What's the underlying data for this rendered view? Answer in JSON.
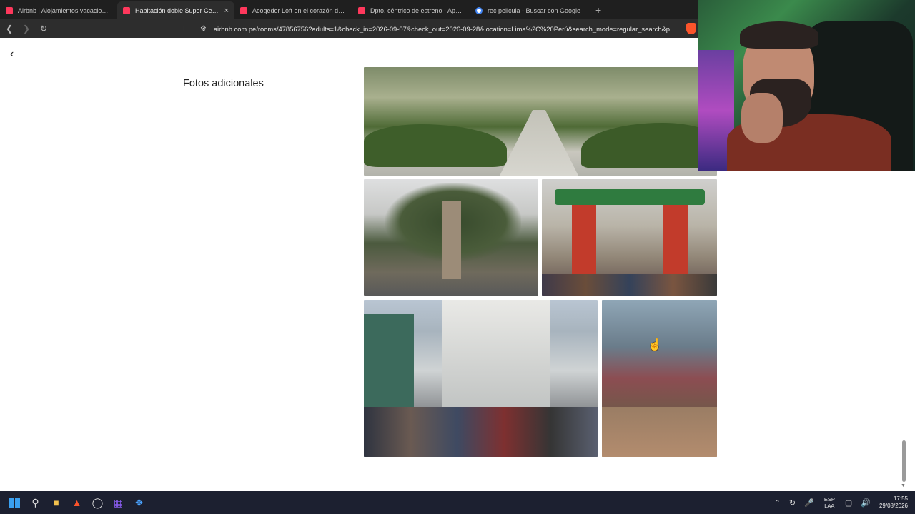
{
  "browser": {
    "tabs": [
      {
        "title": "Airbnb | Alojamientos vacacionales y",
        "favicon_color": "#ff385c",
        "active": false
      },
      {
        "title": "Habitación doble Super Centric",
        "favicon_color": "#ff385c",
        "active": true
      },
      {
        "title": "Acogedor Loft en el corazón de Linc",
        "favicon_color": "#ff385c",
        "active": false
      },
      {
        "title": "Dpto. céntrico de estreno - Apartam",
        "favicon_color": "#ff385c",
        "active": false
      },
      {
        "title": "rec pelicula - Buscar con Google",
        "favicon_color": "#4285f4",
        "active": false
      }
    ],
    "new_tab_label": "+",
    "close_label": "×",
    "url": "airbnb.com.pe/rooms/47856756?adults=1&check_in=2026-09-07&check_out=2026-09-28&location=Lima%2C%20Perú&search_mode=regular_search&p..."
  },
  "page": {
    "back_label": "‹",
    "section_title": "Fotos adicionales",
    "photos": [
      {
        "subject": "park walkway"
      },
      {
        "subject": "church tower with trees"
      },
      {
        "subject": "chinatown gate"
      },
      {
        "subject": "busy shopping street"
      },
      {
        "subject": "shopping mall interior"
      }
    ]
  },
  "taskbar": {
    "language": "ESP",
    "language_sub": "LAA",
    "time": "17:55",
    "date": "29/08/2026"
  }
}
